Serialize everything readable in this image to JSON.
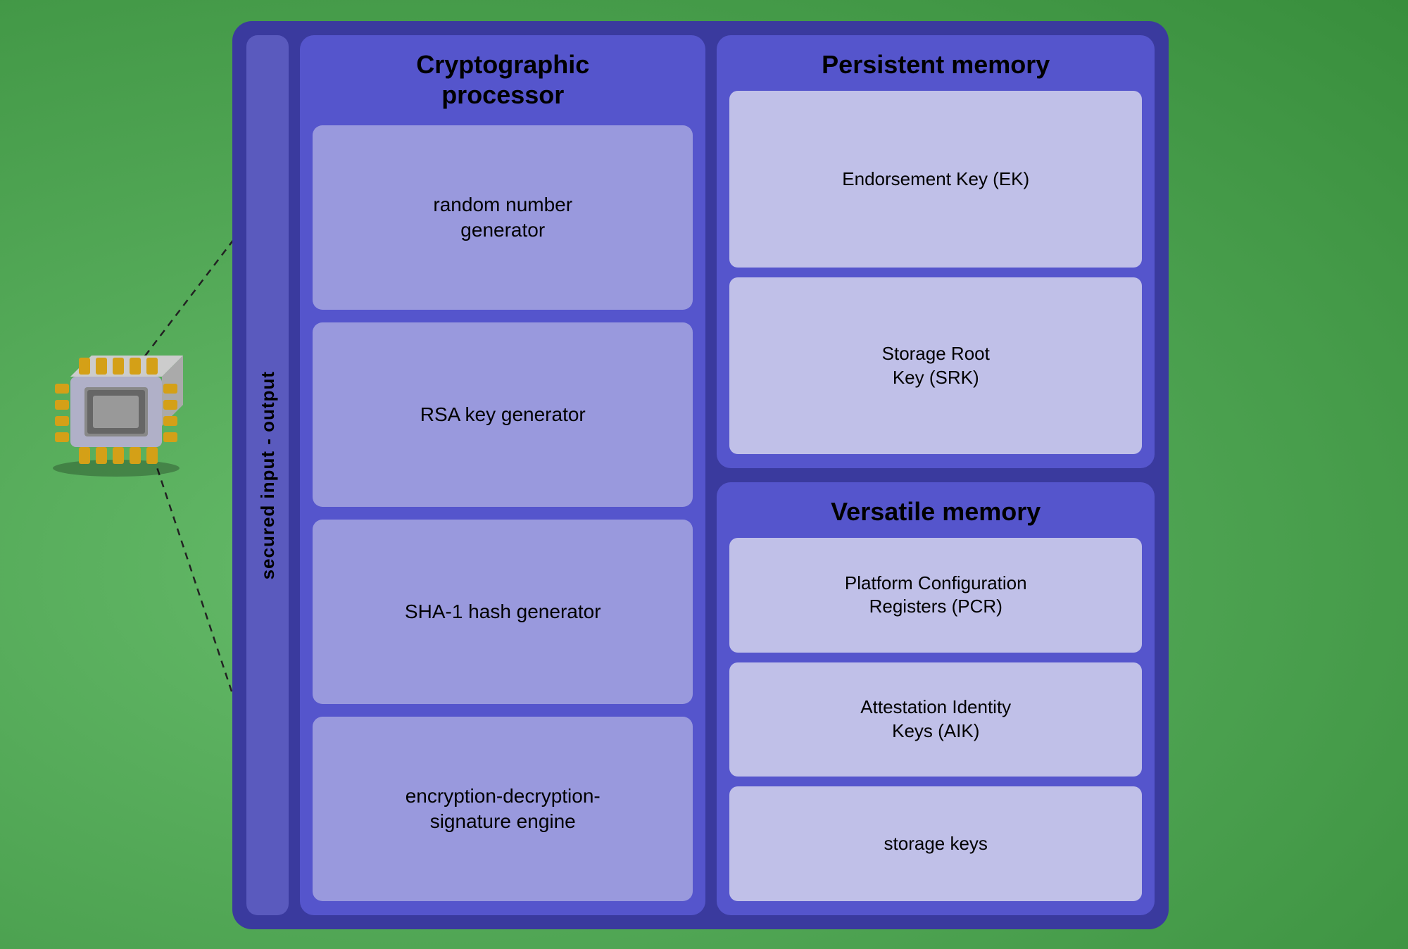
{
  "sidebar": {
    "label": "secured input - output"
  },
  "crypto": {
    "title": "Cryptographic\nprocessor",
    "boxes": [
      {
        "text": "random number\ngenerator"
      },
      {
        "text": "RSA key generator"
      },
      {
        "text": "SHA-1 hash generator"
      },
      {
        "text": "encryption-decryption-\nsignature engine"
      }
    ]
  },
  "persistent_memory": {
    "title": "Persistent memory",
    "boxes": [
      {
        "text": "Endorsement Key (EK)"
      },
      {
        "text": "Storage Root\nKey (SRK)"
      }
    ]
  },
  "versatile_memory": {
    "title": "Versatile memory",
    "boxes": [
      {
        "text": "Platform Configuration\nRegisters (PCR)"
      },
      {
        "text": "Attestation Identity\nKeys (AIK)"
      },
      {
        "text": "storage keys"
      }
    ]
  },
  "colors": {
    "bg_green": "#4caf50",
    "main_dark_blue": "#3a3a9e",
    "medium_blue": "#5555cc",
    "strip_blue": "#5a5abe",
    "light_box": "#9999dd",
    "lighter_box": "#c0c0e8"
  }
}
